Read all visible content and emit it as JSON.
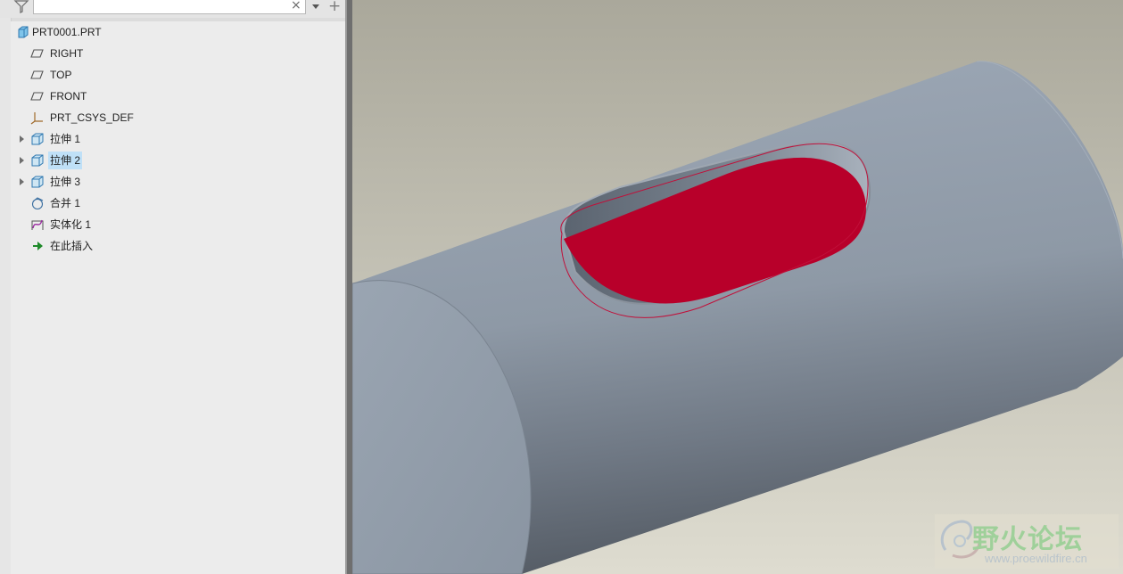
{
  "filter": {
    "search_placeholder": "",
    "search_value": "",
    "clear_glyph": "×",
    "add_glyph": "+"
  },
  "tree": {
    "items": [
      {
        "label": "PRT0001.PRT",
        "icon": "part-icon",
        "expandable": false,
        "selected": false
      },
      {
        "label": "RIGHT",
        "icon": "datum-plane-icon",
        "expandable": false,
        "selected": false
      },
      {
        "label": "TOP",
        "icon": "datum-plane-icon",
        "expandable": false,
        "selected": false
      },
      {
        "label": "FRONT",
        "icon": "datum-plane-icon",
        "expandable": false,
        "selected": false
      },
      {
        "label": "PRT_CSYS_DEF",
        "icon": "csys-icon",
        "expandable": false,
        "selected": false
      },
      {
        "label": "拉伸 1",
        "icon": "extrude-icon",
        "expandable": true,
        "selected": false
      },
      {
        "label": "拉伸 2",
        "icon": "extrude-icon",
        "expandable": true,
        "selected": true
      },
      {
        "label": "拉伸 3",
        "icon": "extrude-icon",
        "expandable": true,
        "selected": false
      },
      {
        "label": "合并 1",
        "icon": "merge-icon",
        "expandable": false,
        "selected": false
      },
      {
        "label": "实体化 1",
        "icon": "solidify-icon",
        "expandable": false,
        "selected": false
      },
      {
        "label": "在此插入",
        "icon": "insert-here-icon",
        "expandable": false,
        "selected": false
      }
    ]
  },
  "watermark": {
    "title": "野火论坛",
    "url": "www.proewildfire.cn"
  },
  "colors": {
    "selection_highlight": "#bfe0f7",
    "model_body": "#8e98a6",
    "highlight_surface": "#b8002a",
    "background_top": "#aaa89b",
    "background_bottom": "#dedcd0"
  }
}
